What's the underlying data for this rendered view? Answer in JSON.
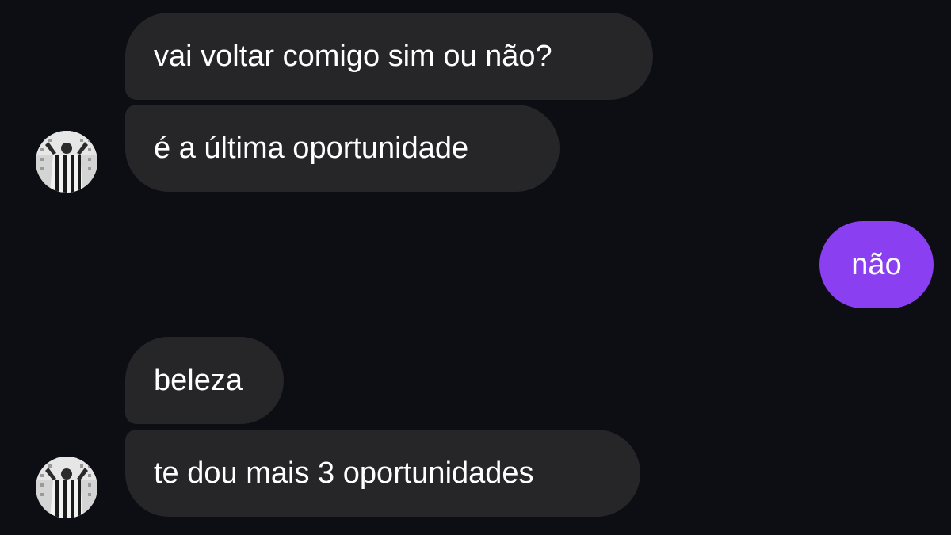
{
  "conversation": {
    "messages": [
      {
        "side": "received",
        "text": "vai voltar comigo sim ou não?"
      },
      {
        "side": "received",
        "text": "é a última oportunidade"
      },
      {
        "side": "sent",
        "text": "não"
      },
      {
        "side": "received",
        "text": "beleza"
      },
      {
        "side": "received",
        "text": "te dou mais 3 oportunidades"
      }
    ]
  },
  "colors": {
    "background": "#0c0e13",
    "received_bubble": "#262628",
    "sent_bubble": "#8a3ff0",
    "text": "#ffffff"
  },
  "icons": {
    "avatar": "avatar-striped-shirt-icon"
  }
}
